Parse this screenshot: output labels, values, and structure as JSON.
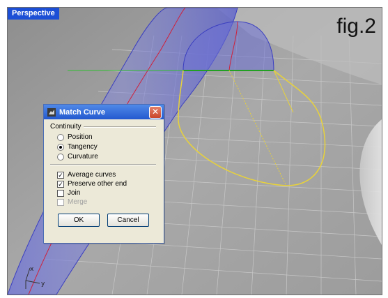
{
  "viewport": {
    "title": "Perspective",
    "figure_label": "fig.2"
  },
  "axes": {
    "x": "x",
    "y": "y"
  },
  "dialog": {
    "title": "Match Curve",
    "close_glyph": "✕",
    "continuity": {
      "label": "Continuity",
      "options": [
        {
          "label": "Position",
          "selected": false
        },
        {
          "label": "Tangency",
          "selected": true
        },
        {
          "label": "Curvature",
          "selected": false
        }
      ]
    },
    "checkboxes": [
      {
        "label": "Average curves",
        "checked": true,
        "enabled": true
      },
      {
        "label": "Preserve other end",
        "checked": true,
        "enabled": true
      },
      {
        "label": "Join",
        "checked": false,
        "enabled": true
      },
      {
        "label": "Merge",
        "checked": false,
        "enabled": false
      }
    ],
    "ok_label": "OK",
    "cancel_label": "Cancel"
  },
  "colors": {
    "viewport_label_bg": "#1c4fd6",
    "surface_blue": "#4a4fd8",
    "curve_yellow": "#e8d23a",
    "edge_green": "#22a022",
    "seam_red": "#d0203a"
  },
  "icons": {
    "dialog": "rhino-icon",
    "close": "close-icon",
    "axis": "axis-icon"
  }
}
